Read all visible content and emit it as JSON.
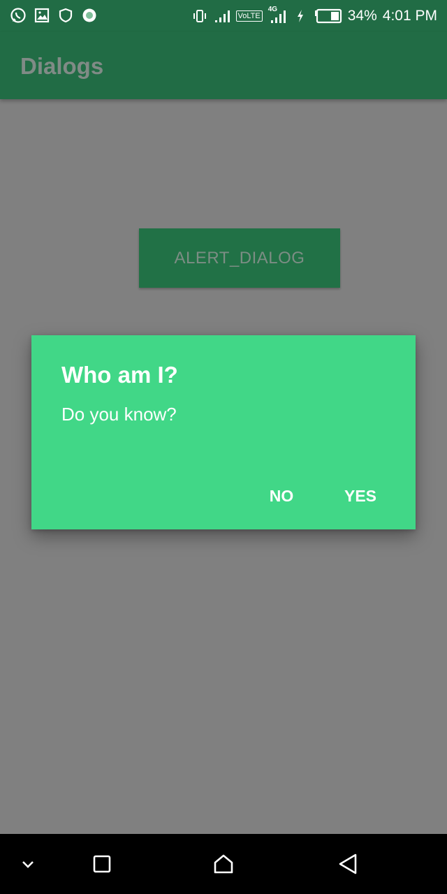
{
  "status_bar": {
    "icons_left": [
      "whatsapp-icon",
      "image-icon",
      "shield-icon",
      "circle-record-icon"
    ],
    "icons_right": [
      "vibrate-icon",
      "signal-icon",
      "volte-icon",
      "4g-signal-icon",
      "charging-icon",
      "battery-icon"
    ],
    "volte_label": "VoLTE",
    "network_label": "4G",
    "battery": "34%",
    "time": "4:01 PM"
  },
  "app_bar": {
    "title": "Dialogs"
  },
  "main": {
    "alert_button_label": "ALERT_DIALOG"
  },
  "dialog": {
    "title": "Who am I?",
    "message": "Do you know?",
    "negative_label": "NO",
    "positive_label": "YES"
  },
  "nav_bar": {
    "icons": [
      "chevron-down-icon",
      "recents-icon",
      "home-icon",
      "back-icon"
    ]
  },
  "colors": {
    "primary_dark": "#216c45",
    "button": "#217146",
    "dialog_bg": "#41d787",
    "scrim": "#808080"
  }
}
